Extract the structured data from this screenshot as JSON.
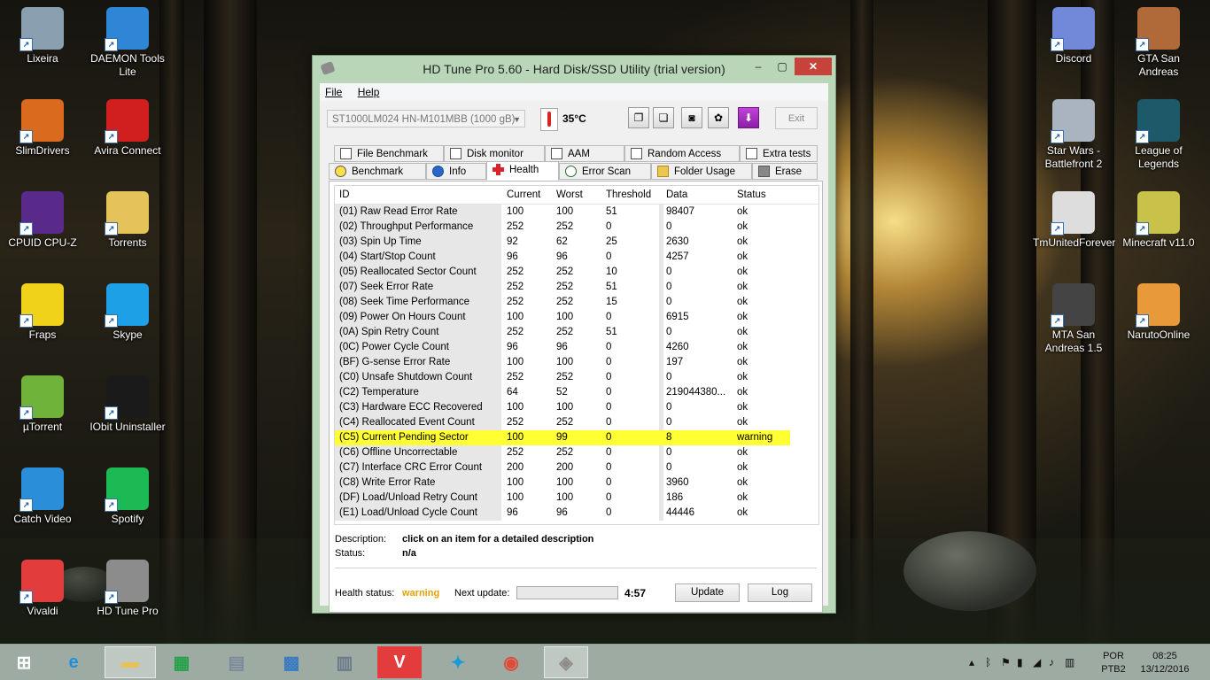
{
  "desktop_icons_left": [
    {
      "label": "Lixeira",
      "icon": "recycle-bin-icon",
      "color": "#8aa0b0"
    },
    {
      "label": "DAEMON Tools Lite",
      "icon": "daemon-tools-icon",
      "color": "#2f86d6"
    },
    {
      "label": "SlimDrivers",
      "icon": "slimdrivers-icon",
      "color": "#d96a1e"
    },
    {
      "label": "Avira Connect",
      "icon": "avira-icon",
      "color": "#d11f1f"
    },
    {
      "label": "CPUID CPU-Z",
      "icon": "cpuz-icon",
      "color": "#5a2a8a"
    },
    {
      "label": "Torrents",
      "icon": "folder-icon",
      "color": "#e6c35a"
    },
    {
      "label": "Fraps",
      "icon": "fraps-icon",
      "color": "#f0d21a"
    },
    {
      "label": "Skype",
      "icon": "skype-icon",
      "color": "#1ea0e6"
    },
    {
      "label": "µTorrent",
      "icon": "utorrent-icon",
      "color": "#6fb33a"
    },
    {
      "label": "IObit Uninstaller",
      "icon": "iobit-icon",
      "color": "#1a1a1a"
    },
    {
      "label": "Catch Video",
      "icon": "catch-video-icon",
      "color": "#2a8fd8"
    },
    {
      "label": "Spotify",
      "icon": "spotify-icon",
      "color": "#1db954"
    },
    {
      "label": "Vivaldi",
      "icon": "vivaldi-icon",
      "color": "#e23c3c"
    },
    {
      "label": "HD Tune Pro",
      "icon": "hdtune-icon",
      "color": "#8c8c8c"
    }
  ],
  "desktop_icons_right": [
    {
      "label": "Discord",
      "icon": "discord-icon",
      "color": "#7289da"
    },
    {
      "label": "GTA San Andreas",
      "icon": "gta-icon",
      "color": "#b06a3a"
    },
    {
      "label": "Star Wars - Battlefront 2",
      "icon": "starwars-icon",
      "color": "#aab4c0"
    },
    {
      "label": "League of Legends",
      "icon": "lol-icon",
      "color": "#1c5a6a"
    },
    {
      "label": "TmUnitedForever",
      "icon": "trackmania-icon",
      "color": "#dddddd"
    },
    {
      "label": "Minecraft v11.0",
      "icon": "minecraft-icon",
      "color": "#c9c24a"
    },
    {
      "label": "MTA San Andreas 1.5",
      "icon": "mta-icon",
      "color": "#444444"
    },
    {
      "label": "NarutoOnline",
      "icon": "naruto-icon",
      "color": "#e89a3a"
    }
  ],
  "window": {
    "title": "HD Tune Pro 5.60 - Hard Disk/SSD Utility (trial version)",
    "min_glyph": "–",
    "max_glyph": "▢",
    "close_glyph": "✕",
    "menu": [
      "File",
      "Help"
    ],
    "drive": "ST1000LM024 HN-M101MBB (1000 gB)",
    "temperature": "35°C",
    "exit_label": "Exit",
    "tabs_row1": [
      "File Benchmark",
      "Disk monitor",
      "AAM",
      "Random Access",
      "Extra tests"
    ],
    "tabs_row2": [
      "Benchmark",
      "Info",
      "Health",
      "Error Scan",
      "Folder Usage",
      "Erase"
    ],
    "active_tab": "Health"
  },
  "health": {
    "columns": [
      "ID",
      "Current",
      "Worst",
      "Threshold",
      "Data",
      "Status"
    ],
    "rows": [
      {
        "id": "(01) Raw Read Error Rate",
        "current": "100",
        "worst": "100",
        "threshold": "51",
        "data": "98407",
        "status": "ok"
      },
      {
        "id": "(02) Throughput Performance",
        "current": "252",
        "worst": "252",
        "threshold": "0",
        "data": "0",
        "status": "ok"
      },
      {
        "id": "(03) Spin Up Time",
        "current": "92",
        "worst": "62",
        "threshold": "25",
        "data": "2630",
        "status": "ok"
      },
      {
        "id": "(04) Start/Stop Count",
        "current": "96",
        "worst": "96",
        "threshold": "0",
        "data": "4257",
        "status": "ok"
      },
      {
        "id": "(05) Reallocated Sector Count",
        "current": "252",
        "worst": "252",
        "threshold": "10",
        "data": "0",
        "status": "ok"
      },
      {
        "id": "(07) Seek Error Rate",
        "current": "252",
        "worst": "252",
        "threshold": "51",
        "data": "0",
        "status": "ok"
      },
      {
        "id": "(08) Seek Time Performance",
        "current": "252",
        "worst": "252",
        "threshold": "15",
        "data": "0",
        "status": "ok"
      },
      {
        "id": "(09) Power On Hours Count",
        "current": "100",
        "worst": "100",
        "threshold": "0",
        "data": "6915",
        "status": "ok"
      },
      {
        "id": "(0A) Spin Retry Count",
        "current": "252",
        "worst": "252",
        "threshold": "51",
        "data": "0",
        "status": "ok"
      },
      {
        "id": "(0C) Power Cycle Count",
        "current": "96",
        "worst": "96",
        "threshold": "0",
        "data": "4260",
        "status": "ok"
      },
      {
        "id": "(BF) G-sense Error Rate",
        "current": "100",
        "worst": "100",
        "threshold": "0",
        "data": "197",
        "status": "ok"
      },
      {
        "id": "(C0) Unsafe Shutdown Count",
        "current": "252",
        "worst": "252",
        "threshold": "0",
        "data": "0",
        "status": "ok"
      },
      {
        "id": "(C2) Temperature",
        "current": "64",
        "worst": "52",
        "threshold": "0",
        "data": "219044380...",
        "status": "ok"
      },
      {
        "id": "(C3) Hardware ECC Recovered",
        "current": "100",
        "worst": "100",
        "threshold": "0",
        "data": "0",
        "status": "ok"
      },
      {
        "id": "(C4) Reallocated Event Count",
        "current": "252",
        "worst": "252",
        "threshold": "0",
        "data": "0",
        "status": "ok"
      },
      {
        "id": "(C5) Current Pending Sector",
        "current": "100",
        "worst": "99",
        "threshold": "0",
        "data": "8",
        "status": "warning"
      },
      {
        "id": "(C6) Offline Uncorrectable",
        "current": "252",
        "worst": "252",
        "threshold": "0",
        "data": "0",
        "status": "ok"
      },
      {
        "id": "(C7) Interface CRC Error Count",
        "current": "200",
        "worst": "200",
        "threshold": "0",
        "data": "0",
        "status": "ok"
      },
      {
        "id": "(C8) Write Error Rate",
        "current": "100",
        "worst": "100",
        "threshold": "0",
        "data": "3960",
        "status": "ok"
      },
      {
        "id": "(DF) Load/Unload Retry Count",
        "current": "100",
        "worst": "100",
        "threshold": "0",
        "data": "186",
        "status": "ok"
      },
      {
        "id": "(E1) Load/Unload Cycle Count",
        "current": "96",
        "worst": "96",
        "threshold": "0",
        "data": "44446",
        "status": "ok"
      }
    ],
    "description_label": "Description:",
    "description_value": "click on an item for a detailed description",
    "status_label": "Status:",
    "status_value": "n/a",
    "health_status_label": "Health status:",
    "health_status_value": "warning",
    "next_update_label": "Next update:",
    "next_update_progress": 0.0,
    "next_update_time": "4:57",
    "update_button": "Update",
    "log_button": "Log"
  },
  "taskbar": {
    "apps": [
      {
        "name": "start",
        "icon": "windows-start-icon",
        "color": "#ffffff",
        "glyph": "⊞"
      },
      {
        "name": "ie",
        "icon": "internet-explorer-icon",
        "color": "#1e8fe0",
        "glyph": "e"
      },
      {
        "name": "explorer",
        "icon": "file-explorer-icon",
        "color": "#e6c35a",
        "glyph": "▬"
      },
      {
        "name": "store",
        "icon": "store-icon",
        "color": "#26a14a",
        "glyph": "▦"
      },
      {
        "name": "monitor",
        "icon": "resource-monitor-icon",
        "color": "#7a8a9a",
        "glyph": "▤"
      },
      {
        "name": "control",
        "icon": "control-panel-icon",
        "color": "#3a7ac0",
        "glyph": "▩"
      },
      {
        "name": "calculator",
        "icon": "calculator-icon",
        "color": "#6a7a8a",
        "glyph": "▥"
      },
      {
        "name": "vivaldi",
        "icon": "vivaldi-icon",
        "color": "#e23c3c",
        "glyph": "V"
      },
      {
        "name": "kodi",
        "icon": "kodi-icon",
        "color": "#1a9ad8",
        "glyph": "✦"
      },
      {
        "name": "chrome",
        "icon": "chrome-icon",
        "color": "#dd4b39",
        "glyph": "◉"
      },
      {
        "name": "hdtune",
        "icon": "hdtune-icon",
        "color": "#8c8c8c",
        "glyph": "◈"
      }
    ],
    "lang_top": "POR",
    "lang_bottom": "PTB2",
    "time": "08:25",
    "date": "13/12/2016"
  }
}
